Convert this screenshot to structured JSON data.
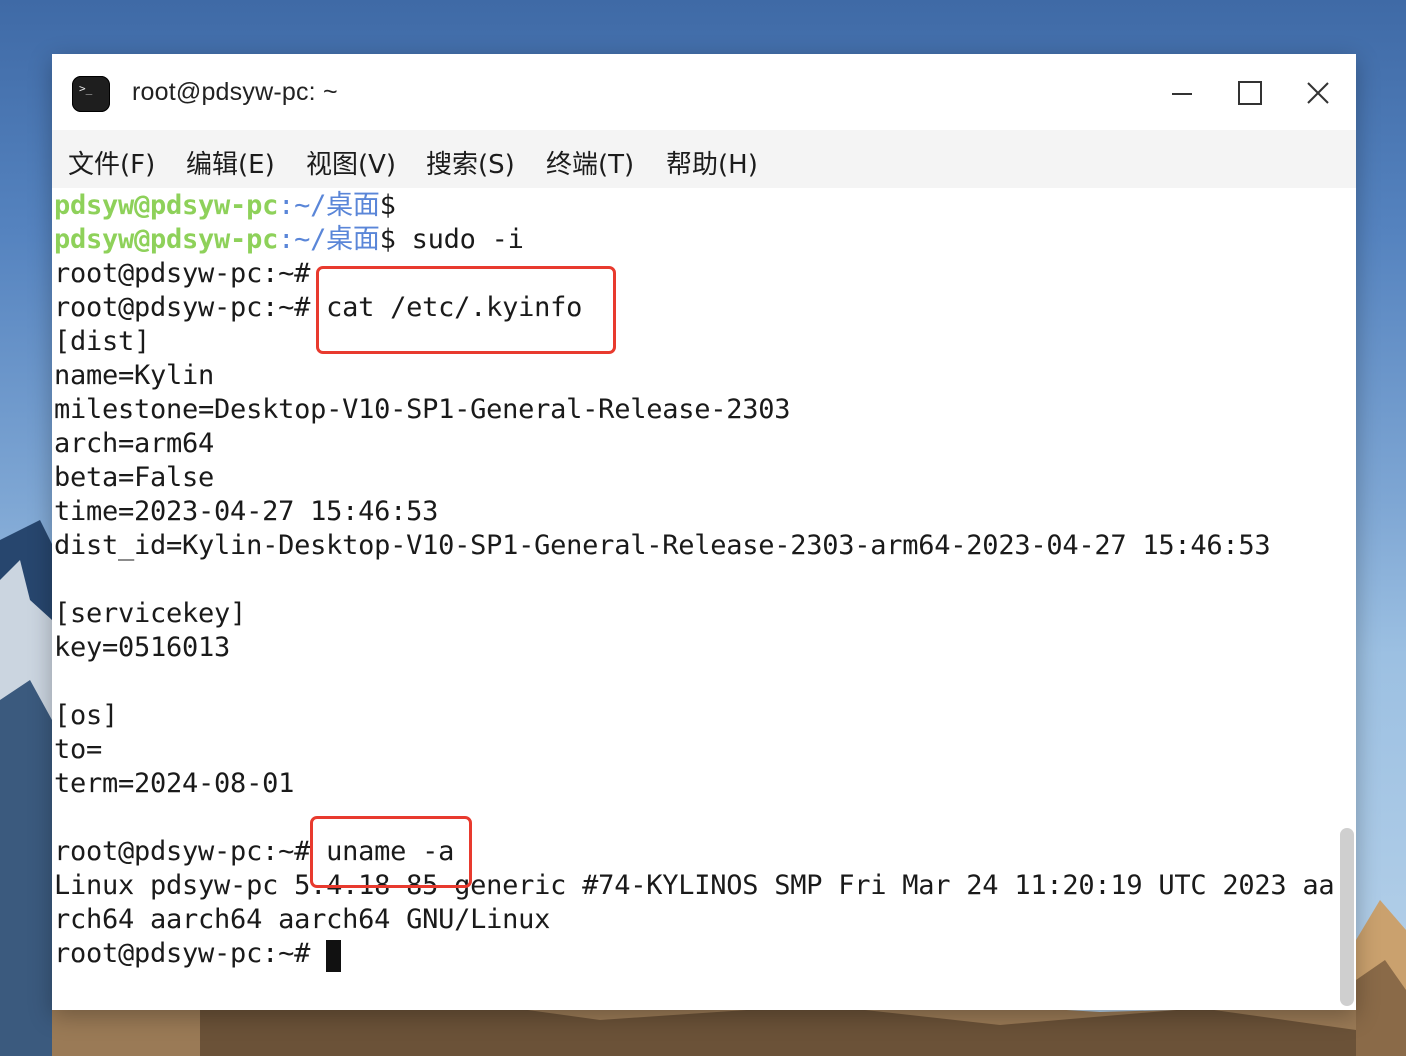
{
  "window": {
    "title": "root@pdsyw-pc: ~",
    "app_icon_glyph": ">_",
    "controls": [
      "minimize",
      "maximize",
      "close"
    ]
  },
  "menu": [
    "文件(F)",
    "编辑(E)",
    "视图(V)",
    "搜索(S)",
    "终端(T)",
    "帮助(H)"
  ],
  "terminal": {
    "user_prompt": {
      "user": "pdsyw@pdsyw-pc",
      "path": ":~/桌面",
      "symbol": "$"
    },
    "lines": [
      "",
      " sudo -i",
      "root@pdsyw-pc:~#",
      "root@pdsyw-pc:~# cat /etc/.kyinfo",
      "[dist]",
      "name=Kylin",
      "milestone=Desktop-V10-SP1-General-Release-2303",
      "arch=arm64",
      "beta=False",
      "time=2023-04-27 15:46:53",
      "dist_id=Kylin-Desktop-V10-SP1-General-Release-2303-arm64-2023-04-27 15:46:53",
      "",
      "[servicekey]",
      "key=0516013",
      "",
      "[os]",
      "to=",
      "term=2024-08-01",
      "",
      "root@pdsyw-pc:~# uname -a",
      "Linux pdsyw-pc 5.4.18-85-generic #74-KYLINOS SMP Fri Mar 24 11:20:19 UTC 2023 aa",
      "rch64 aarch64 aarch64 GNU/Linux",
      "root@pdsyw-pc:~# "
    ]
  },
  "colors": {
    "prompt_user": "#8ed15a",
    "prompt_path": "#5a86d8",
    "highlight_box": "#e83a2e"
  }
}
